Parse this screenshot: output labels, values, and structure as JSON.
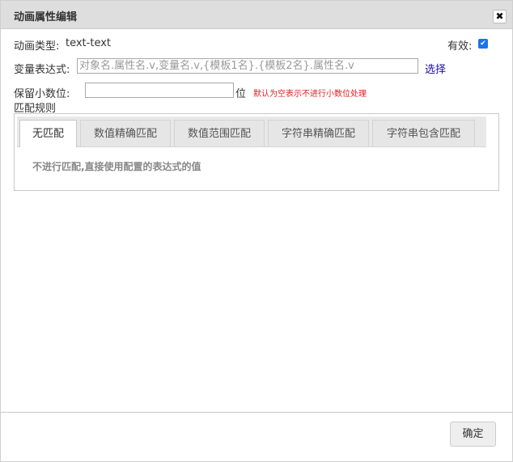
{
  "dialog": {
    "title": "动画属性编辑",
    "close_glyph": "✖"
  },
  "form": {
    "anim_type_label": "动画类型:",
    "anim_type_value": "text-text",
    "valid_label": "有效:",
    "valid_checked": true,
    "expr_label": "变量表达式:",
    "expr_placeholder": "对象名.属性名.v,变量名.v,{模板1名}.{模板2名}.属性名.v",
    "select_link": "选择",
    "decimal_label": "保留小数位:",
    "decimal_value": "",
    "decimal_unit": "位",
    "decimal_hint": "默认为空表示不进行小数位处理",
    "match_rules_label": "匹配规则"
  },
  "tabs": [
    {
      "label": "无匹配",
      "active": true
    },
    {
      "label": "数值精确匹配",
      "active": false
    },
    {
      "label": "数值范围匹配",
      "active": false
    },
    {
      "label": "字符串精确匹配",
      "active": false
    },
    {
      "label": "字符串包含匹配",
      "active": false
    }
  ],
  "tab_content": "不进行匹配,直接使用配置的表达式的值",
  "footer": {
    "ok_label": "确定"
  },
  "colors": {
    "accent": "#1a73e8",
    "link": "#1a0dab",
    "hint": "#e02020"
  }
}
